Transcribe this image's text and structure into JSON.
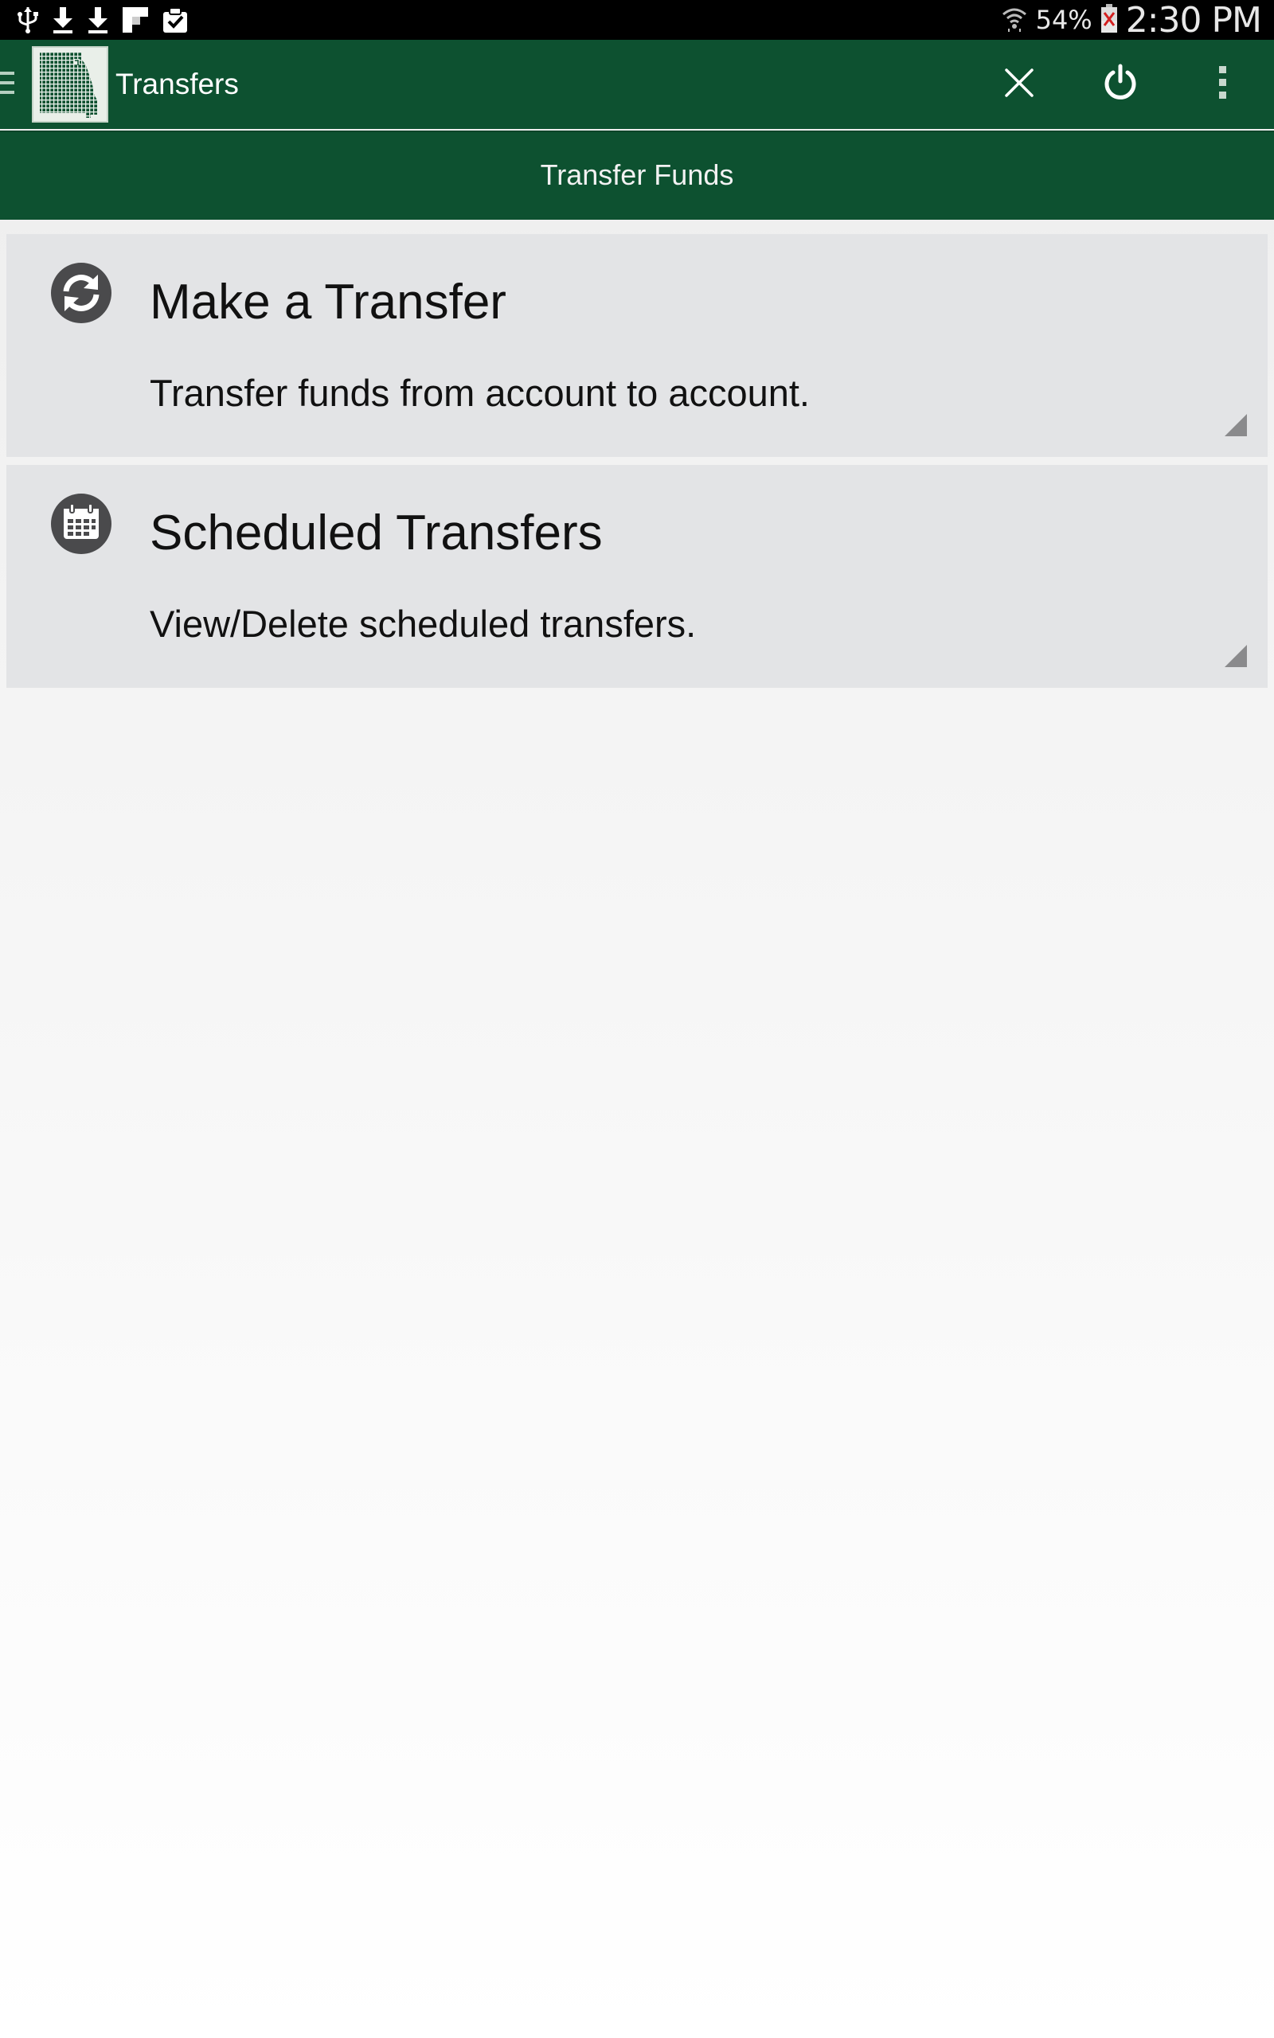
{
  "status_bar": {
    "notification_icons": [
      "usb-icon",
      "download-icon",
      "download-icon",
      "flipboard-icon",
      "clipboard-check-icon"
    ],
    "battery_percent": "54%",
    "time": "2:30 PM"
  },
  "action_bar": {
    "title": "Transfers",
    "logo": "missouri-state-logo",
    "actions": [
      "close-icon",
      "power-icon",
      "overflow-menu-icon"
    ]
  },
  "sub_bar": {
    "title": "Transfer Funds"
  },
  "cards": [
    {
      "icon": "refresh-icon",
      "title": "Make a Transfer",
      "description": "Transfer funds from account to account."
    },
    {
      "icon": "calendar-icon",
      "title": "Scheduled Transfers",
      "description": "View/Delete scheduled transfers."
    }
  ],
  "colors": {
    "brand_green": "#0d5130",
    "card_background": "#e3e4e6",
    "icon_gray": "#4a4a4c"
  }
}
